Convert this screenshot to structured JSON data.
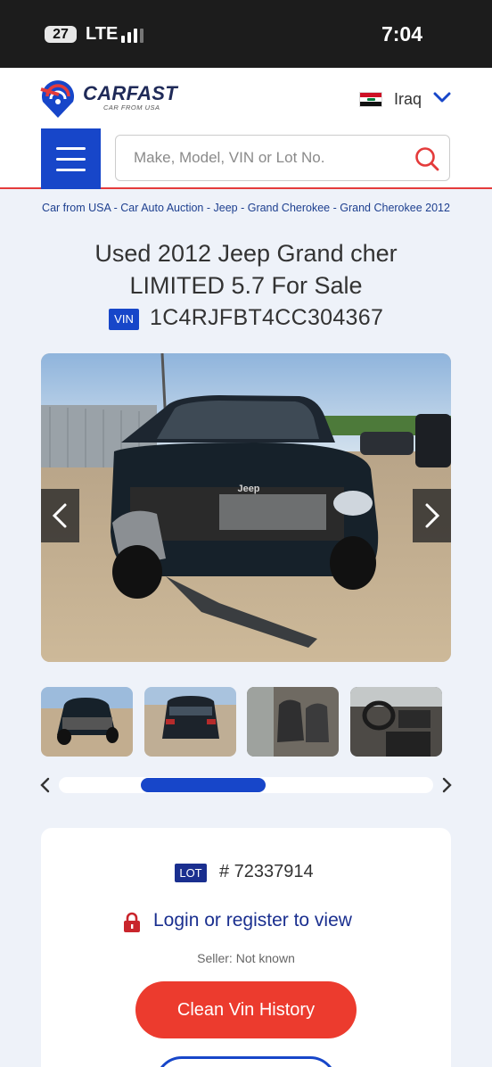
{
  "status_bar": {
    "badge": "27",
    "network": "LTE",
    "time": "7:04"
  },
  "header": {
    "brand": "CARFAST",
    "tagline": "CAR FROM USA",
    "country": "Iraq"
  },
  "search": {
    "placeholder": "Make, Model, VIN or Lot No."
  },
  "breadcrumb": [
    "Car from USA",
    "Car Auto Auction",
    "Jeep",
    "Grand Cherokee",
    "Grand Cherokee 2012"
  ],
  "breadcrumb_separator": " - ",
  "listing": {
    "title": "Used 2012 Jeep Grand cher LIMITED 5.7 For Sale",
    "vin_label": "VIN",
    "vin": "1C4RJFBT4CC304367",
    "lot_label": "LOT",
    "lot_number": "# 72337914",
    "login_text": "Login or register to view",
    "seller": "Seller: Not known",
    "clean_vin_button": "Clean Vin History"
  },
  "gallery": {
    "thumbnails": [
      "front damage",
      "rear view",
      "front seats",
      "dashboard"
    ],
    "scroll_position": 0.33
  }
}
